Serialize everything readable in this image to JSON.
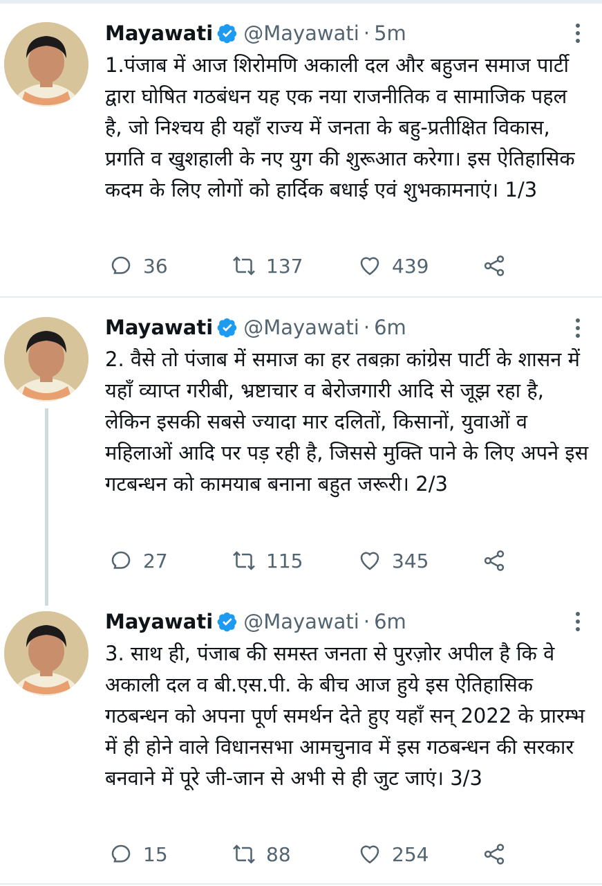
{
  "colors": {
    "verified": "#1d9bf0",
    "secondary_text": "#536471",
    "divider": "#e6ecf0",
    "thread_line": "#cfd9de"
  },
  "tweets": [
    {
      "name": "Mayawati",
      "handle": "@Mayawati",
      "separator": "·",
      "time": "5m",
      "text": "1.पंजाब में आज शिरोमणि अकाली दल और बहुजन समाज पार्टी द्वारा घोषित गठबंधन यह एक नया राजनीतिक व सामाजिक पहल है, जो निश्चय ही यहाँ राज्य में जनता के बहु-प्रतीक्षित विकास, प्रगति व खुशहाली के नए युग की शुरूआत करेगा। इस ऐतिहासिक कदम के लिए लोगों को हार्दिक बधाई एवं शुभकामनाएं। 1/3",
      "replies": "36",
      "retweets": "137",
      "likes": "439"
    },
    {
      "name": "Mayawati",
      "handle": "@Mayawati",
      "separator": "·",
      "time": "6m",
      "text": "2. वैसे तो पंजाब में समाज का हर तबक़ा कांग्रेस पार्टी के शासन में यहाँ व्याप्त गरीबी, भ्रष्टाचार व बेरोजगारी आदि से जूझ रहा है, लेकिन इसकी सबसे ज्यादा मार दलितों, किसानों, युवाओं व महिलाओं आदि पर पड़ रही है, जिससे मुक्ति पाने के लिए अपने इस गटबन्धन को कामयाब बनाना बहुत जरूरी। 2/3",
      "replies": "27",
      "retweets": "115",
      "likes": "345"
    },
    {
      "name": "Mayawati",
      "handle": "@Mayawati",
      "separator": "·",
      "time": "6m",
      "text": "3. साथ ही, पंजाब की समस्त जनता से पुरज़ोर अपील है कि वे अकाली दल व बी.एस.पी. के बीच आज हुये इस ऐतिहासिक गठबन्धन को अपना पूर्ण समर्थन देते हुए यहाँ सन् 2022 के प्रारम्भ में ही होने वाले विधानसभा आमचुनाव में इस गठबन्धन की सरकार बनवाने में पूरे जी-जान से अभी से ही जुट जाएं। 3/3",
      "replies": "15",
      "retweets": "88",
      "likes": "254"
    }
  ]
}
